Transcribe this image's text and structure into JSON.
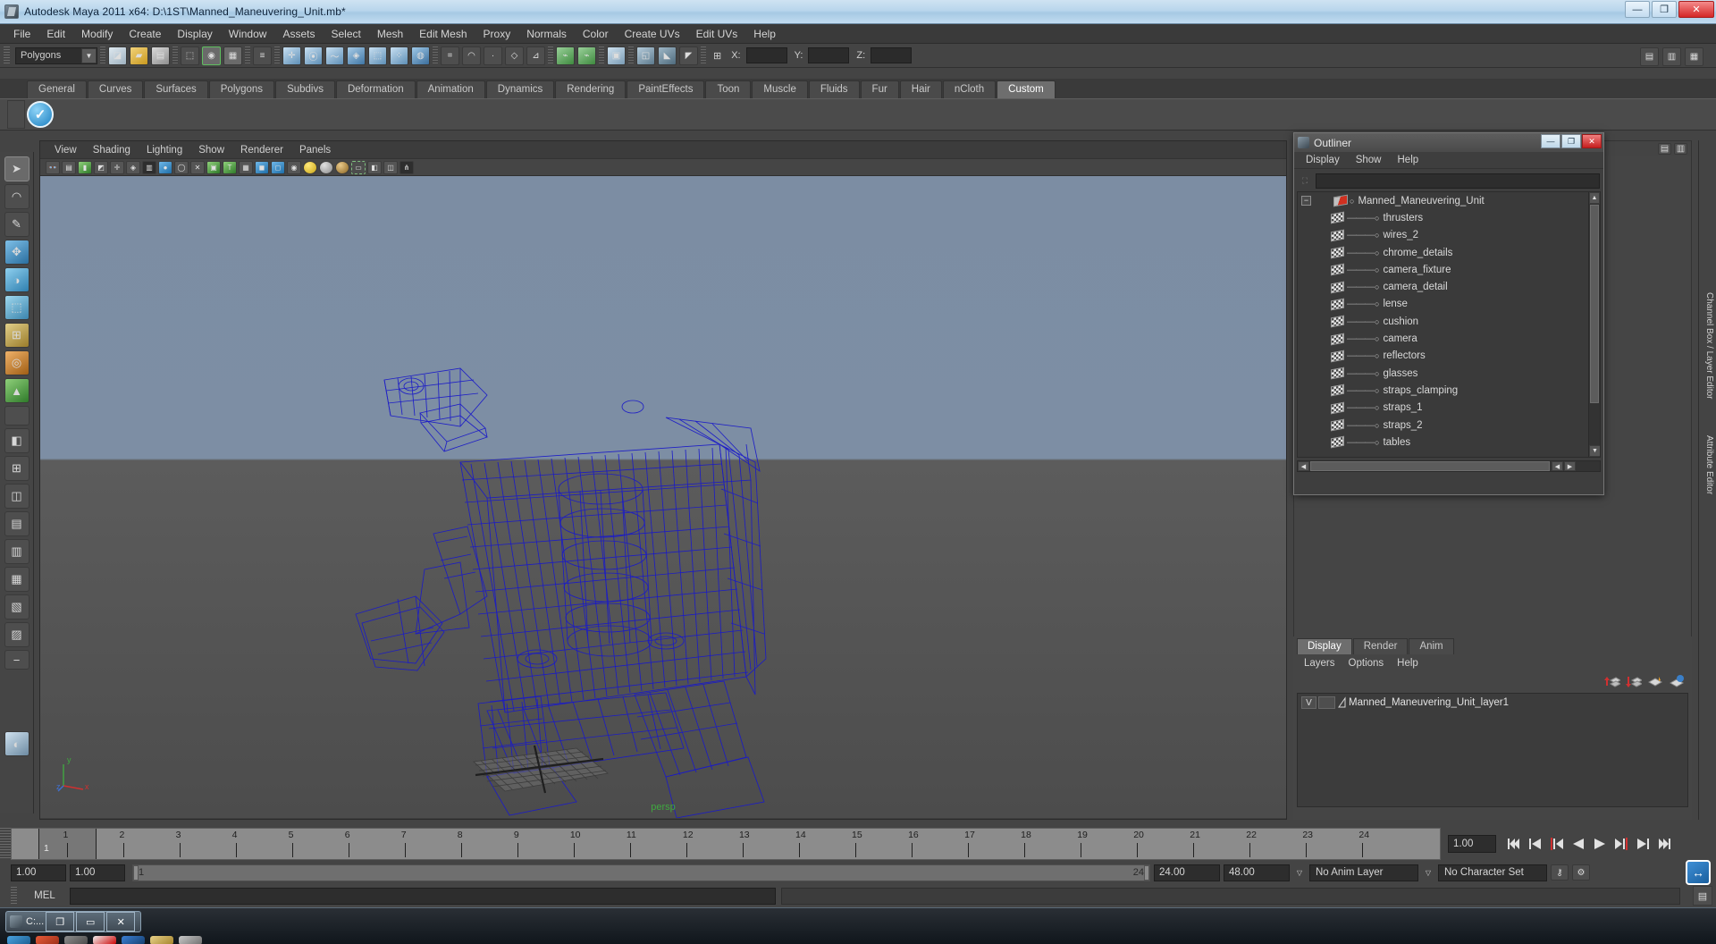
{
  "window": {
    "title": "Autodesk Maya 2011 x64: D:\\1ST\\Manned_Maneuvering_Unit.mb*",
    "app_icon": "maya-icon",
    "minimize": "—",
    "maximize": "❐",
    "close": "✕"
  },
  "menubar": {
    "items": [
      "File",
      "Edit",
      "Modify",
      "Create",
      "Display",
      "Window",
      "Assets",
      "Select",
      "Mesh",
      "Edit Mesh",
      "Proxy",
      "Normals",
      "Color",
      "Create UVs",
      "Edit UVs",
      "Help"
    ]
  },
  "statusline": {
    "mode": "Polygons",
    "mode_arrow": "▼",
    "x_label": "X:",
    "y_label": "Y:",
    "z_label": "Z:",
    "x_value": "",
    "y_value": "",
    "z_value": ""
  },
  "shelf": {
    "tabs": [
      "General",
      "Curves",
      "Surfaces",
      "Polygons",
      "Subdivs",
      "Deformation",
      "Animation",
      "Dynamics",
      "Rendering",
      "PaintEffects",
      "Toon",
      "Muscle",
      "Fluids",
      "Fur",
      "Hair",
      "nCloth",
      "Custom"
    ],
    "active_tab": "Custom",
    "button_glyph": "✓"
  },
  "viewport": {
    "menus": [
      "View",
      "Shading",
      "Lighting",
      "Show",
      "Renderer",
      "Panels"
    ],
    "camera_label": "persp",
    "axis": {
      "x": "x",
      "y": "y",
      "z": "z"
    },
    "background_top": "#7c8da3",
    "background_bottom": "#4c4c4c",
    "wireframe_color": "#1a1ac8"
  },
  "right_rails": {
    "labels": [
      "Channel Box / Layer Editor",
      "Attribute Editor"
    ]
  },
  "outliner": {
    "title": "Outliner",
    "icon": "maya-icon",
    "minimize": "—",
    "maximize": "❐",
    "close": "✕",
    "menus": [
      "Display",
      "Show",
      "Help"
    ],
    "search_value": "",
    "search_placeholder": "",
    "root": {
      "label": "Manned_Maneuvering_Unit",
      "expanded": true,
      "expand_glyph": "−"
    },
    "children": [
      "thrusters",
      "wires_2",
      "chrome_details",
      "camera_fixture",
      "camera_detail",
      "lense",
      "cushion",
      "camera",
      "reflectors",
      "glasses",
      "straps_clamping",
      "straps_1",
      "straps_2",
      "tables"
    ]
  },
  "layer_editor": {
    "tabs": [
      "Display",
      "Render",
      "Anim"
    ],
    "active_tab": "Display",
    "menus": [
      "Layers",
      "Options",
      "Help"
    ],
    "layers": [
      {
        "visibility": "V",
        "playback": "",
        "name": "Manned_Maneuvering_Unit_layer1"
      }
    ]
  },
  "timeslider": {
    "ticks": [
      1,
      2,
      3,
      4,
      5,
      6,
      7,
      8,
      9,
      10,
      11,
      12,
      13,
      14,
      15,
      16,
      17,
      18,
      19,
      20,
      21,
      22,
      23,
      24
    ],
    "current_frame": "1",
    "current_frame_field": "1.00",
    "playback_buttons": [
      "go-to-start",
      "step-back-keyframe",
      "step-back-frame",
      "play-backwards",
      "play-forwards",
      "step-forward-frame",
      "step-forward-keyframe",
      "go-to-end"
    ]
  },
  "rangeslider": {
    "start_field": "1.00",
    "end_field": "1.00",
    "bar_start": "1",
    "bar_end": "24",
    "anim_start": "24.00",
    "anim_end": "48.00",
    "anim_layer": "No Anim Layer",
    "character_set": "No Character Set",
    "dropdown_arrow": "▽"
  },
  "command_line": {
    "label": "MEL",
    "input_value": "",
    "output_value": ""
  },
  "taskbar": {
    "window_label": "C:...",
    "restore": "❐",
    "minimize": "▭",
    "close": "✕"
  }
}
